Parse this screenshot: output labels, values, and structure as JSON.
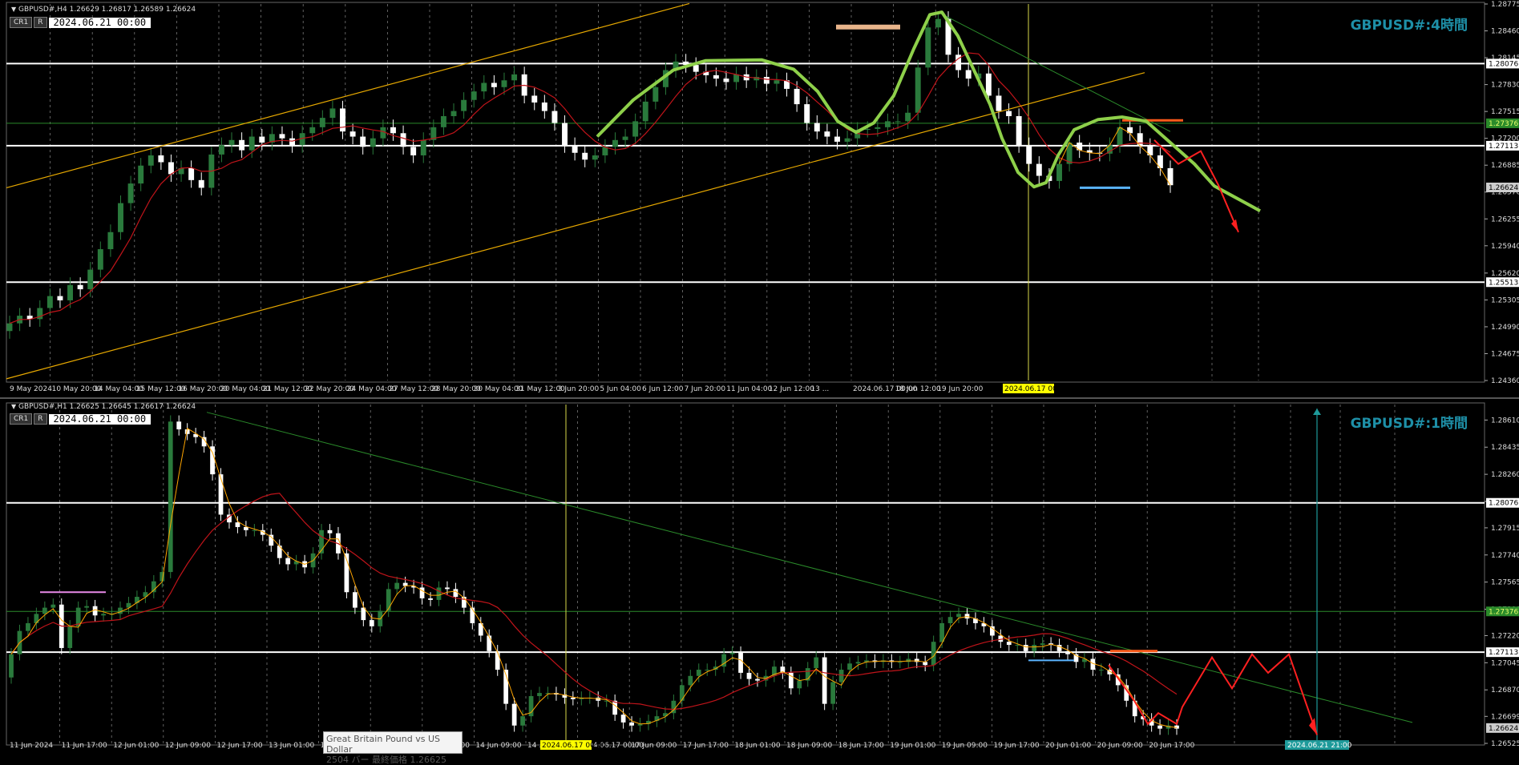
{
  "panes": [
    {
      "symbol_line": "GBPUSD#,H4  1.26629 1.26817 1.26589 1.26624",
      "buttons": [
        "CR1",
        "R"
      ],
      "date_value": "2024.06.21 00:00",
      "title": "GBPUSD#:4時間",
      "yticks": [
        "1.28775",
        "1.28460",
        "1.28145",
        "1.27830",
        "1.27515",
        "1.27200",
        "1.26885",
        "1.26570",
        "1.26255",
        "1.25940",
        "1.25620",
        "1.25305",
        "1.24990",
        "1.24675",
        "1.24360"
      ],
      "ylim": [
        1.2436,
        1.28775
      ],
      "price_tags": [
        {
          "value": 1.28076,
          "label": "1.28076",
          "color": "#ffffff",
          "kind": "white"
        },
        {
          "value": 1.27376,
          "label": "1.27376",
          "color": "#2f9e2f",
          "kind": "green"
        },
        {
          "value": 1.27113,
          "label": "1.27113",
          "color": "#ffffff",
          "kind": "white"
        },
        {
          "value": 1.26624,
          "label": "1.26624",
          "color": "#cccccc",
          "kind": "bid"
        },
        {
          "value": 1.25513,
          "label": "1.25513",
          "color": "#ffffff",
          "kind": "white"
        }
      ],
      "xticks": [
        "9 May 2024",
        "10 May 20:00",
        "14 May 04:00",
        "15 May 12:00",
        "16 May 20:00",
        "20 May 04:00",
        "21 May 12:00",
        "22 May 20:00",
        "24 May 04:00",
        "27 May 12:00",
        "28 May 20:00",
        "30 May 04:00",
        "31 May 12:00",
        "3 Jun 20:00",
        "5 Jun 04:00",
        "6 Jun 12:00",
        "7 Jun 20:00",
        "11 Jun 04:00",
        "12 Jun 12:00",
        "13 ...",
        "2024.06.17 00:00",
        "18 Jun 12:00",
        "19 Jun 20:00"
      ],
      "cursor_date": "2024.06.17 00:00",
      "chart_data": {
        "type": "candlestick",
        "series": [
          {
            "name": "close",
            "values": [
              1.2503,
              1.2512,
              1.2508,
              1.2521,
              1.2535,
              1.253,
              1.2548,
              1.2543,
              1.2566,
              1.259,
              1.261,
              1.2644,
              1.2667,
              1.2688,
              1.27,
              1.2692,
              1.2678,
              1.2685,
              1.2671,
              1.2662,
              1.2701,
              1.2712,
              1.2718,
              1.2706,
              1.2722,
              1.2715,
              1.2725,
              1.272,
              1.2712,
              1.2726,
              1.2733,
              1.2744,
              1.2755,
              1.2728,
              1.2722,
              1.271,
              1.272,
              1.2733,
              1.2726,
              1.271,
              1.27,
              1.2718,
              1.2733,
              1.2746,
              1.2752,
              1.2765,
              1.2775,
              1.2785,
              1.278,
              1.2788,
              1.2795,
              1.277,
              1.2762,
              1.2752,
              1.2738,
              1.2712,
              1.2703,
              1.2695,
              1.27,
              1.271,
              1.2718,
              1.2722,
              1.274,
              1.2763,
              1.278,
              1.28,
              1.281,
              1.2806,
              1.2798,
              1.2794,
              1.279,
              1.2786,
              1.2795,
              1.2788,
              1.2792,
              1.2784,
              1.2788,
              1.2778,
              1.276,
              1.2738,
              1.2728,
              1.2722,
              1.2716,
              1.272,
              1.273,
              1.2731,
              1.2733,
              1.274,
              1.274,
              1.275,
              1.2803,
              1.285,
              1.286,
              1.2818,
              1.28,
              1.279,
              1.2796,
              1.277,
              1.2752,
              1.2746,
              1.2712,
              1.269,
              1.2676,
              1.267,
              1.269,
              1.2715,
              1.2706,
              1.2703,
              1.2702,
              1.2712,
              1.2733,
              1.2726,
              1.2711,
              1.27,
              1.2685,
              1.2665
            ]
          }
        ]
      }
    },
    {
      "symbol_line": "GBPUSD#,H1  1.26625 1.26645 1.26617 1.26624",
      "buttons": [
        "CR1",
        "R"
      ],
      "date_value": "2024.06.21 00:00",
      "title": "GBPUSD#:1時間",
      "yticks": [
        "1.28610",
        "1.28435",
        "1.28260",
        "1.28085",
        "1.27915",
        "1.27740",
        "1.27565",
        "1.27390",
        "1.27220",
        "1.27045",
        "1.26870",
        "1.26699",
        "1.26525"
      ],
      "ylim": [
        1.26525,
        1.2871
      ],
      "price_tags": [
        {
          "value": 1.28076,
          "label": "1.28076",
          "color": "#ffffff",
          "kind": "white"
        },
        {
          "value": 1.27376,
          "label": "1.27376",
          "color": "#2f9e2f",
          "kind": "green"
        },
        {
          "value": 1.27113,
          "label": "1.27113",
          "color": "#ffffff",
          "kind": "white"
        },
        {
          "value": 1.26624,
          "label": "1.26624",
          "color": "#cccccc",
          "kind": "bid"
        }
      ],
      "xticks": [
        "11 Jun 2024",
        "11 Jun 17:00",
        "12 Jun 01:00",
        "12 Jun 09:00",
        "12 Jun 17:00",
        "13 Jun 01:00",
        "13 Jun 09:00",
        "13 Jun 17:00",
        "14 Jun 01:00",
        "14 Jun 09:00",
        "14 ...",
        "2024.06.17 00:00",
        "17 Jun 09:00",
        "17 Jun 17:00",
        "18 Jun 01:00",
        "18 Jun 09:00",
        "18 Jun 17:00",
        "19 Jun 01:00",
        "19 Jun 09:00",
        "19 Jun 17:00",
        "20 Jun 01:00",
        "20 Jun 09:00",
        "20 Jun 17:00"
      ],
      "cursor_date": "2024.06.17 00:00",
      "future_date": "2024.06.21 21:00",
      "chart_data": {
        "type": "candlestick",
        "series": [
          {
            "name": "close",
            "values": [
              1.271,
              1.2725,
              1.273,
              1.2736,
              1.274,
              1.2742,
              1.2714,
              1.2728,
              1.274,
              1.2741,
              1.2735,
              1.2736,
              1.2736,
              1.274,
              1.2743,
              1.2747,
              1.275,
              1.2757,
              1.2763,
              1.286,
              1.2855,
              1.2852,
              1.285,
              1.2844,
              1.2826,
              1.28,
              1.2795,
              1.2792,
              1.279,
              1.279,
              1.2787,
              1.278,
              1.2772,
              1.2768,
              1.277,
              1.2766,
              1.2775,
              1.279,
              1.2788,
              1.2775,
              1.275,
              1.274,
              1.2732,
              1.2728,
              1.2738,
              1.2752,
              1.2756,
              1.2754,
              1.2753,
              1.2746,
              1.2745,
              1.2753,
              1.2752,
              1.2747,
              1.274,
              1.273,
              1.2722,
              1.2712,
              1.27,
              1.2678,
              1.2664,
              1.267,
              1.2683,
              1.2685,
              1.2685,
              1.2684,
              1.2682,
              1.2681,
              1.2682,
              1.2682,
              1.268,
              1.268,
              1.2671,
              1.2666,
              1.2664,
              1.2665,
              1.2667,
              1.267,
              1.2672,
              1.268,
              1.269,
              1.2696,
              1.27,
              1.27,
              1.2702,
              1.271,
              1.2711,
              1.2698,
              1.2694,
              1.2693,
              1.2696,
              1.2702,
              1.2698,
              1.2688,
              1.2693,
              1.2701,
              1.2708,
              1.2678,
              1.2692,
              1.27,
              1.2704,
              1.2705,
              1.2706,
              1.2705,
              1.2706,
              1.2705,
              1.2705,
              1.2707,
              1.2705,
              1.2703,
              1.2718,
              1.273,
              1.2734,
              1.2736,
              1.2733,
              1.273,
              1.2728,
              1.2722,
              1.2718,
              1.2716,
              1.2716,
              1.2712,
              1.2716,
              1.2717,
              1.2716,
              1.2712,
              1.271,
              1.2705,
              1.2707,
              1.27,
              1.27,
              1.2697,
              1.269,
              1.268,
              1.267,
              1.2668,
              1.2664,
              1.2662,
              1.2664,
              1.2662
            ]
          }
        ]
      }
    }
  ],
  "tooltip": {
    "line1": "Great Britain Pound vs US Dollar",
    "line2": "2504 バー  最終価格  1.26625"
  },
  "colors": {
    "up_candle": "#2a7a3c",
    "down_candle": "#ffffff",
    "ma_red": "#c0141a",
    "ma_yellow": "#ffa500",
    "pattern_green": "#8ed04a",
    "forecast_red": "#ff2020",
    "level_white": "#ffffff",
    "level_green": "#2a8a2a",
    "title_teal": "#1e90a8"
  }
}
